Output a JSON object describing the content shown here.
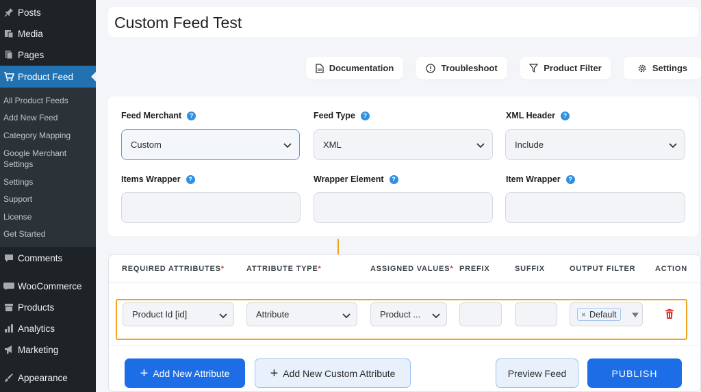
{
  "sidebar": {
    "menu": [
      {
        "label": "Posts",
        "icon": "pin-icon"
      },
      {
        "label": "Media",
        "icon": "media-icon"
      },
      {
        "label": "Pages",
        "icon": "pages-icon"
      },
      {
        "label": "Product Feed",
        "icon": "cart-icon",
        "active": true
      }
    ],
    "submenu": [
      "All Product Feeds",
      "Add New Feed",
      "Category Mapping",
      "Google Merchant Settings",
      "Settings",
      "Support",
      "License",
      "Get Started"
    ],
    "menu_bottom": [
      {
        "label": "Comments",
        "icon": "comment-icon"
      },
      {
        "label": "WooCommerce",
        "icon": "woo-icon"
      },
      {
        "label": "Products",
        "icon": "box-icon"
      },
      {
        "label": "Analytics",
        "icon": "analytics-icon"
      },
      {
        "label": "Marketing",
        "icon": "megaphone-icon"
      },
      {
        "label": "Appearance",
        "icon": "brush-icon"
      }
    ]
  },
  "page": {
    "title": "Custom Feed Test"
  },
  "toolbar": {
    "documentation": "Documentation",
    "troubleshoot": "Troubleshoot",
    "product_filter": "Product Filter",
    "settings": "Settings"
  },
  "config": {
    "feed_merchant": {
      "label": "Feed Merchant",
      "value": "Custom"
    },
    "feed_type": {
      "label": "Feed Type",
      "value": "XML"
    },
    "xml_header": {
      "label": "XML Header",
      "value": "Include"
    },
    "items_wrapper": {
      "label": "Items Wrapper",
      "value": ""
    },
    "wrapper_element": {
      "label": "Wrapper Element",
      "value": ""
    },
    "item_wrapper": {
      "label": "Item Wrapper",
      "value": ""
    },
    "help": "?"
  },
  "table": {
    "headers": {
      "required": "REQUIRED ATTRIBUTES",
      "type": "ATTRIBUTE TYPE",
      "assigned": "ASSIGNED VALUES",
      "prefix": "PREFIX",
      "suffix": "SUFFIX",
      "output": "OUTPUT FILTER",
      "action": "ACTION",
      "req_mark": "*"
    },
    "row": {
      "attribute": "Product Id [id]",
      "type": "Attribute",
      "assigned": "Product ...",
      "prefix": "",
      "suffix": "",
      "output_tag": "Default",
      "remove_x": "×"
    }
  },
  "actions": {
    "add_attribute": "Add New Attribute",
    "add_custom": "Add New Custom Attribute",
    "preview": "Preview Feed",
    "publish": "PUBLISH",
    "plus": "+"
  },
  "colors": {
    "accent": "#1d6ee6",
    "sidebar_active": "#2271b1",
    "highlight_outline": "#f2a21b",
    "delete": "#e0352b"
  }
}
